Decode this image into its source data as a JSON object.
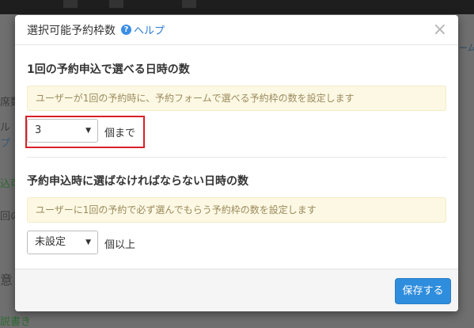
{
  "background": {
    "fragments": [
      "席数",
      "ル",
      "プ",
      "込可",
      "回の",
      "意",
      "説書き"
    ],
    "right_fragment": "ーム"
  },
  "modal": {
    "title": "選択可能予約枠数",
    "help_label": "ヘルプ",
    "help_icon_glyph": "?",
    "close_glyph": "×",
    "section1": {
      "title": "1回の予約申込で選べる日時の数",
      "info": "ユーザーが1回の予約時に、予約フォームで選べる予約枠の数を設定します",
      "select_value": "3",
      "unit": "個まで"
    },
    "section2": {
      "title": "予約申込時に選ばなければならない日時の数",
      "info": "ユーザーに1回の予約で必ず選んでもらう予約枠の数を設定します",
      "select_value": "未設定",
      "unit": "個以上"
    },
    "save_label": "保存する"
  },
  "colors": {
    "accent": "#2f8ddd",
    "highlight": "#d9202a",
    "info_bg": "#fcf8e3"
  }
}
